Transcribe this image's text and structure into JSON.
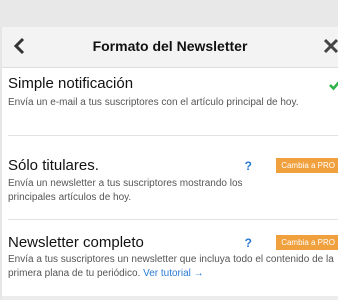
{
  "header": {
    "title": "Formato del Newsletter",
    "back_icon": "chevron-left-icon",
    "close_icon": "close-icon"
  },
  "options": [
    {
      "title": "Simple notificación",
      "description": "Envía un e-mail a tus suscriptores con el artículo principal de hoy.",
      "selected": true,
      "icon": "check-icon"
    },
    {
      "title": "Sólo titulares.",
      "description": "Envía un newsletter a tus suscriptores mostrando los principales artículos de hoy.",
      "help": "?",
      "badge": "Cambia a PRO"
    },
    {
      "title": "Newsletter completo",
      "description": "Envía a tus suscriptores un newsletter que incluya todo el contenido de la primera plana de tu periódico.",
      "help": "?",
      "badge": "Cambia a PRO",
      "link": "Ver tutorial →"
    }
  ],
  "colors": {
    "accent": "#2a7ad3",
    "check": "#2db34a",
    "pro_badge": "#f0a03c",
    "header_bg": "#f3f3f3"
  }
}
